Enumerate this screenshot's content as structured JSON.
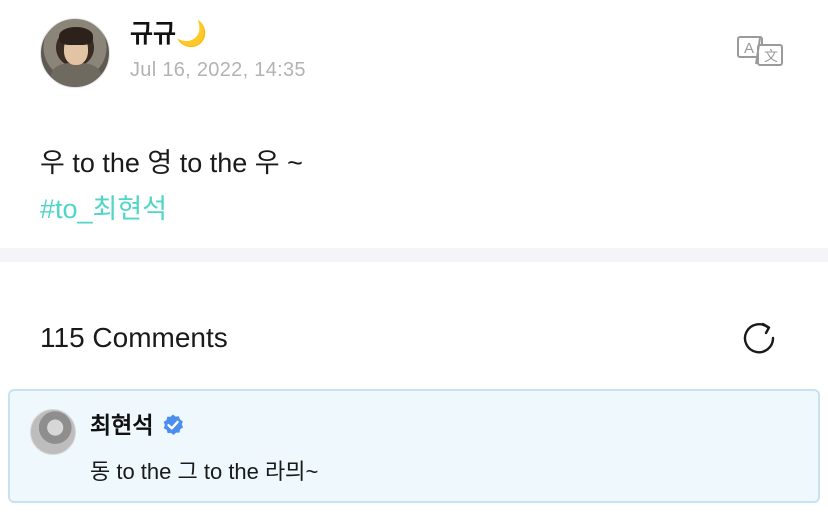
{
  "post": {
    "author": "규규🌙",
    "timestamp": "Jul 16, 2022, 14:35",
    "text": "우 to the 영 to the 우 ~",
    "hashtag": "#to_최현석",
    "translate_icon": "translate-icon"
  },
  "comments": {
    "header": "115 Comments",
    "refresh_icon": "refresh-icon",
    "items": [
      {
        "author": "최현석",
        "verified": true,
        "text": "동 to the 그 to the 라믜~"
      }
    ]
  },
  "colors": {
    "hashtag": "#4fd6c7",
    "verified_badge": "#4a8ef0",
    "comment_highlight_bg": "#eef8fd",
    "comment_highlight_border": "#c7e3f3",
    "timestamp": "#b3b3b3"
  }
}
